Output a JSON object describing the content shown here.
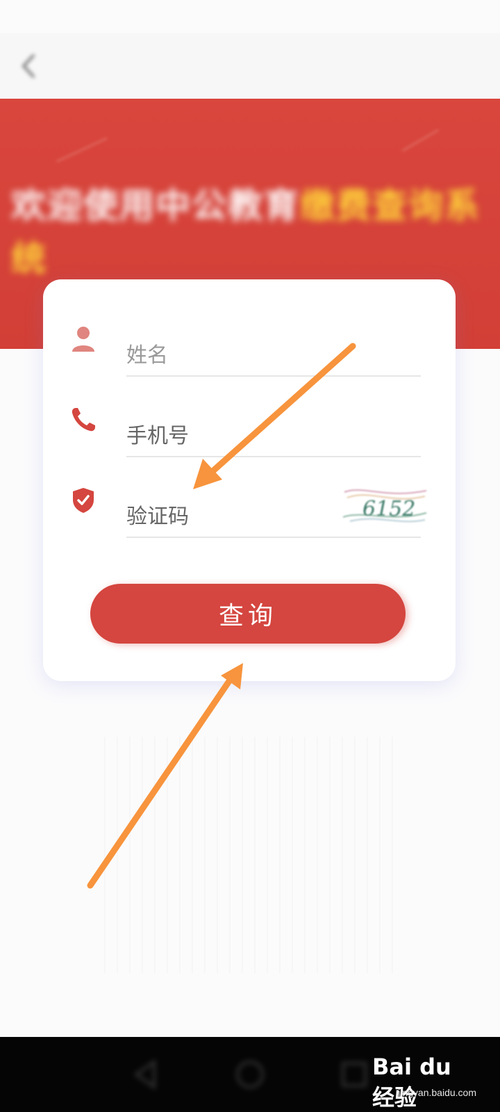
{
  "status_bar": {
    "left_text": "",
    "right_text": ""
  },
  "header": {
    "title": ""
  },
  "banner": {
    "text_white": "欢迎使用中公教育",
    "text_yellow": "缴费查询系统",
    "colors": {
      "background": "#d4463f",
      "highlight": "#ffd43a"
    }
  },
  "form": {
    "name": {
      "placeholder": "姓名",
      "icon": "user-icon"
    },
    "phone": {
      "label": "手机号",
      "icon": "phone-icon"
    },
    "code": {
      "label": "验证码",
      "icon": "shield-check-icon",
      "captcha": "6152"
    },
    "query_label": "查询"
  },
  "watermark": {
    "logo": "Bai du 经验",
    "url": "jingyan.baidu.com"
  },
  "colors": {
    "accent": "#d4463f",
    "arrow": "#f7943d"
  }
}
